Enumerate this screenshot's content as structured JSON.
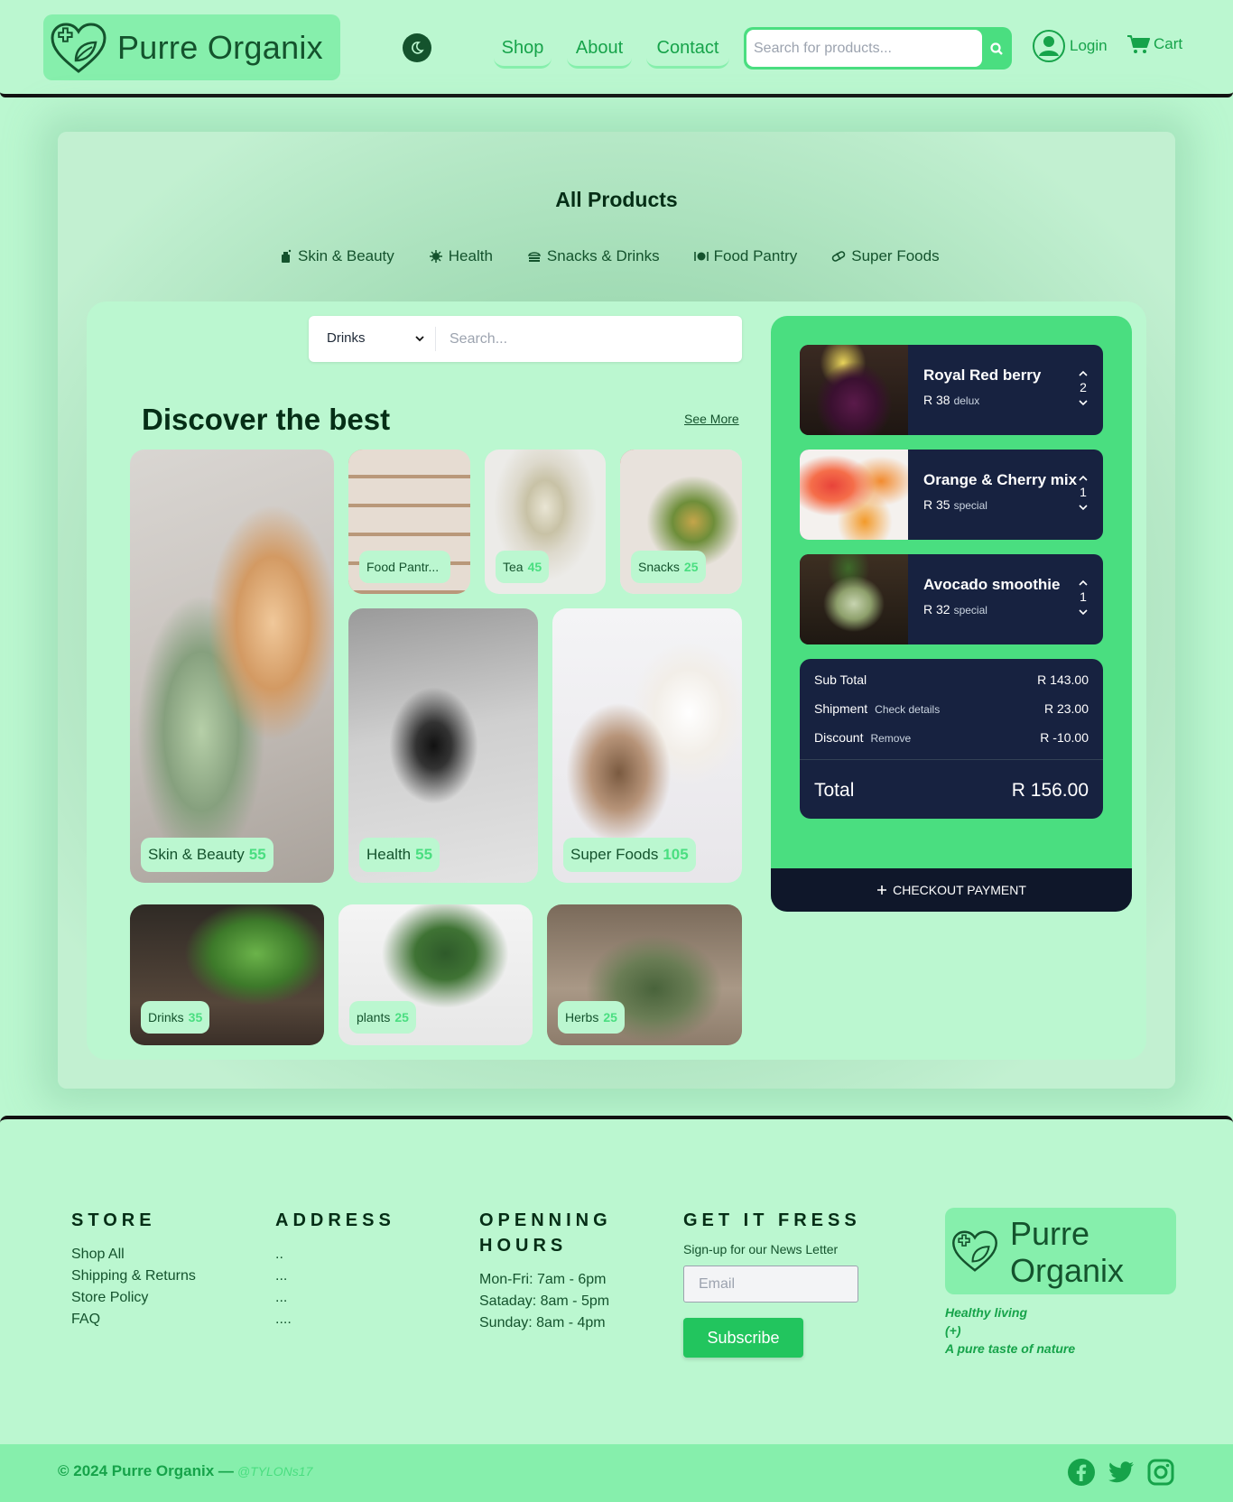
{
  "header": {
    "brand": "Purre Organix",
    "nav": [
      "Shop",
      "About",
      "Contact"
    ],
    "search_placeholder": "Search for products...",
    "login": "Login",
    "cart": "Cart"
  },
  "main": {
    "title": "All Products",
    "categories": [
      "Skin & Beauty",
      "Health",
      "Snacks & Drinks",
      "Food Pantry",
      "Super Foods"
    ],
    "filter": {
      "selected": "Drinks",
      "placeholder": "Search..."
    },
    "discover": {
      "bold": "Discover",
      "rest": " the best",
      "see_more": "See More"
    },
    "tiles": [
      {
        "label": "Skin & Beauty",
        "count": "55"
      },
      {
        "label": "Food Pantr...",
        "count": ""
      },
      {
        "label": "Tea",
        "count": "45"
      },
      {
        "label": "Snacks",
        "count": "25"
      },
      {
        "label": "Health",
        "count": "55"
      },
      {
        "label": "Super Foods",
        "count": "105"
      },
      {
        "label": "Drinks",
        "count": "35"
      },
      {
        "label": "plants",
        "count": "25"
      },
      {
        "label": "Herbs",
        "count": "25"
      }
    ]
  },
  "cart": {
    "items": [
      {
        "name": "Royal Red berry",
        "price": "R 38",
        "tag": "delux",
        "qty": "2"
      },
      {
        "name": "Orange & Cherry mix",
        "price": "R 35",
        "tag": "special",
        "qty": "1"
      },
      {
        "name": "Avocado smoothie",
        "price": "R 32",
        "tag": "special",
        "qty": "1"
      }
    ],
    "subtotal_label": "Sub Total",
    "subtotal": "R 143.00",
    "shipment_label": "Shipment",
    "shipment_link": "Check details",
    "shipment": "R 23.00",
    "discount_label": "Discount",
    "discount_link": "Remove",
    "discount": "R -10.00",
    "total_label": "Total",
    "total": "R 156.00",
    "checkout": "CHECKOUT PAYMENT"
  },
  "footer": {
    "store": {
      "title": "STORE",
      "links": [
        "Shop All",
        "Shipping & Returns",
        "Store Policy",
        "FAQ"
      ]
    },
    "address": {
      "title": "ADDRESS",
      "lines": [
        "..",
        "...",
        "...",
        "...."
      ]
    },
    "hours": {
      "title_1": "OPENNING",
      "title_2": "HOURS",
      "lines": [
        "Mon-Fri: 7am - 6pm",
        "Sataday: 8am - 5pm",
        "Sunday: 8am - 4pm"
      ]
    },
    "news": {
      "title": "GET IT FRESS",
      "subtitle": "Sign-up for our News Letter",
      "email_placeholder": "Email",
      "button": "Subscribe"
    },
    "brand_1": "Purre",
    "brand_2": "Organix",
    "slogan": [
      "Healthy living",
      "(+)",
      "A pure taste of nature"
    ],
    "copyright": "© 2024 Purre Organix —",
    "handle": "@TYLONs17"
  },
  "colors": {
    "accent": "#4ade80",
    "bg": "#bbf7d0",
    "dark": "#172240",
    "brand": "#86efac"
  }
}
